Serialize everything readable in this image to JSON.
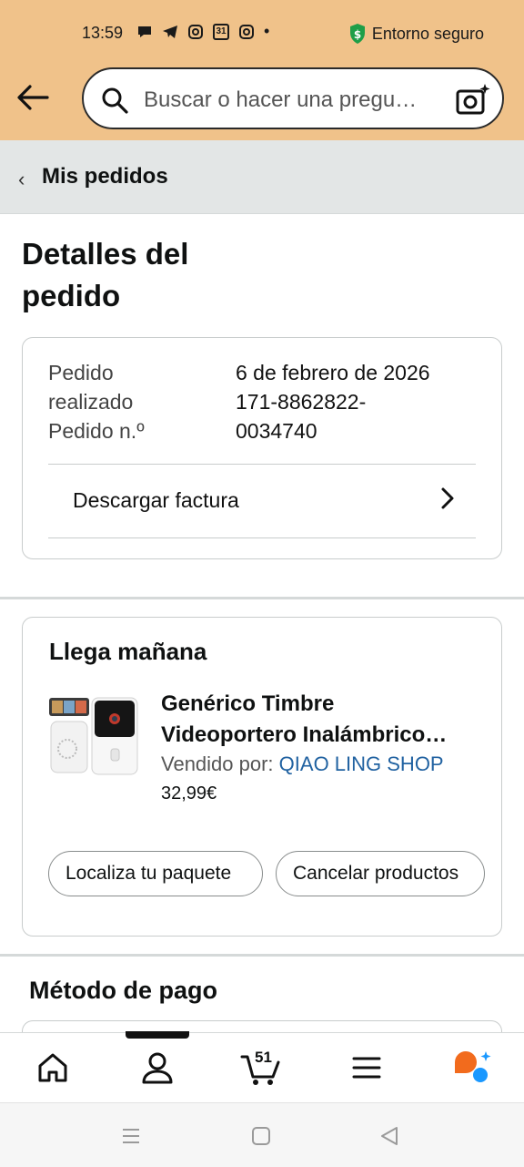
{
  "status_bar": {
    "time": "13:59",
    "secure_label": "Entorno seguro",
    "calendar_day": "31",
    "dot": "•"
  },
  "search": {
    "placeholder": "Buscar o hacer una pregu…"
  },
  "breadcrumb": {
    "label": "Mis pedidos"
  },
  "page": {
    "title_line1": "Detalles del",
    "title_line2": "pedido"
  },
  "order": {
    "placed_label_1": "Pedido",
    "placed_label_2": "realizado",
    "placed_value": "6 de febrero de 2026",
    "number_label": "Pedido n.º",
    "number_value_1": "171-8862822-",
    "number_value_2": "0034740",
    "invoice_label": "Descargar factura"
  },
  "shipment": {
    "arrival": "Llega mañana",
    "product_line1": "Genérico Timbre",
    "product_line2": "Videoportero Inalámbrico…",
    "sold_by_label": "Vendido por: ",
    "seller": "QIAO LING SHOP",
    "price": "32,99€",
    "track_button": "Localiza tu paquete",
    "cancel_button": "Cancelar productos"
  },
  "payment": {
    "heading": "Método de pago"
  },
  "bottom_nav": {
    "cart_count": "51",
    "items": [
      "home-icon",
      "account-icon",
      "cart-icon",
      "menu-icon",
      "assistant-icon"
    ]
  },
  "colors": {
    "header_bg": "#f0c28a",
    "link": "#2162a1",
    "secure_green": "#1e9e48",
    "assistant_orange": "#f26b1d",
    "assistant_blue": "#1a98ff"
  }
}
